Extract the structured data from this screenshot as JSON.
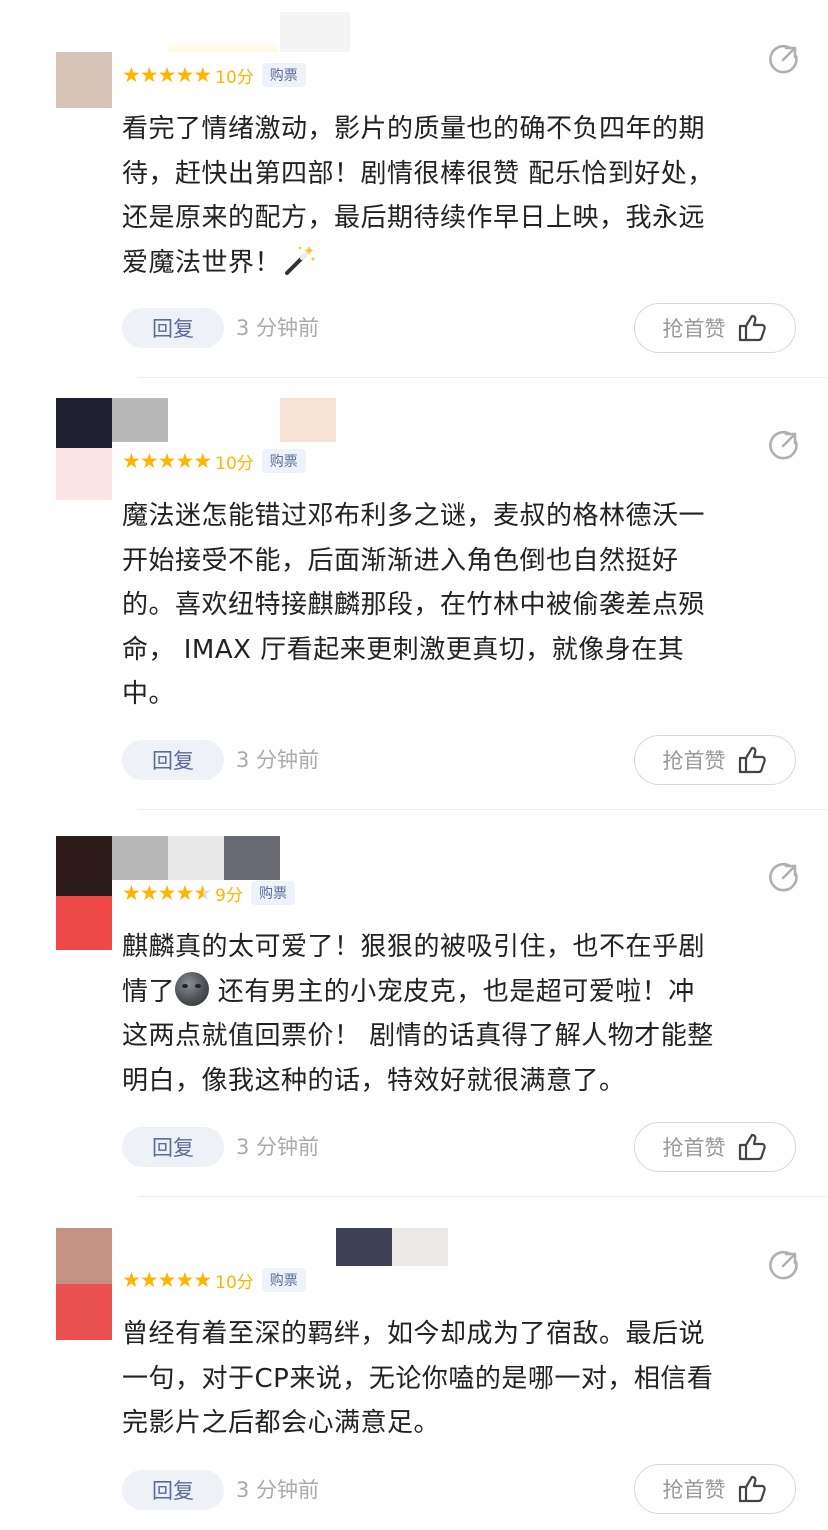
{
  "comments": [
    {
      "score": "10分",
      "buy_badge": "购票",
      "text": "看完了情绪激动，影片的质量也的确不负四年的期\n待，赶快出第四部！剧情很棒很赞 配乐恰到好处，\n还是原来的配方，最后期待续作早日上映，我永远\n爱魔法世界！",
      "emoji": "magic-wand-icon",
      "reply_label": "回复",
      "time": "3 分钟前",
      "like_label": "抢首赞",
      "stars": 5
    },
    {
      "score": "10分",
      "buy_badge": "购票",
      "text": "魔法迷怎能错过邓布利多之谜，麦叔的格林德沃一\n开始接受不能，后面渐渐进入角色倒也自然挺好\n的。喜欢纽特接麒麟那段，在竹林中被偷袭差点殒\n命， IMAX 厅看起来更刺激更真切，就像身在其\n中。",
      "reply_label": "回复",
      "time": "3 分钟前",
      "like_label": "抢首赞",
      "stars": 5
    },
    {
      "score": "9分",
      "buy_badge": "购票",
      "text_a": "麒麟真的太可爱了！狠狠的被吸引住，也不在乎剧\n情了",
      "emoji": "new-moon-face-icon",
      "text_b": " 还有男主的小宠皮克，也是超可爱啦！冲\n这两点就值回票价！ 剧情的话真得了解人物才能整\n明白，像我这种的话，特效好就很满意了。",
      "reply_label": "回复",
      "time": "3 分钟前",
      "like_label": "抢首赞",
      "stars": 4.5
    },
    {
      "score": "10分",
      "buy_badge": "购票",
      "text": "曾经有着至深的羁绊，如今却成为了宿敌。最后说\n一句，对于CP来说，无论你嗑的是哪一对，相信看\n完影片之后都会心满意足。",
      "reply_label": "回复",
      "time": "3 分钟前",
      "like_label": "抢首赞",
      "stars": 5
    }
  ],
  "icons": {
    "share": "share-icon",
    "thumbs_up": "thumbs-up-icon",
    "star": "star-icon"
  },
  "colors": {
    "star": "#ffb400",
    "reply_bg": "#eef1f6",
    "reply_text": "#5a6c98",
    "time_text": "#aaaaaa",
    "divider": "#ececec"
  }
}
